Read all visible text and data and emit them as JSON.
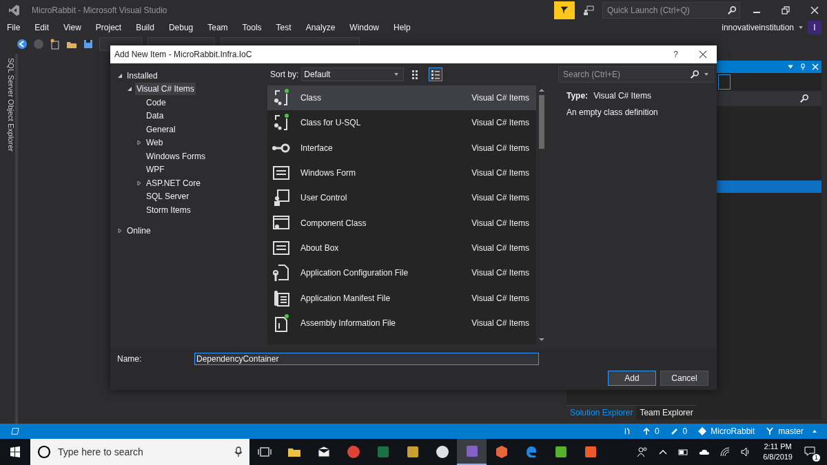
{
  "window": {
    "title": "MicroRabbit - Microsoft Visual Studio",
    "quick_launch": {
      "placeholder": "Quick Launch (Ctrl+Q)"
    },
    "account": "innovativeinstitution",
    "avatar": "I"
  },
  "menu": [
    "File",
    "Edit",
    "View",
    "Project",
    "Build",
    "Debug",
    "Team",
    "Tools",
    "Test",
    "Analyze",
    "Window",
    "Help"
  ],
  "side_tab": "SQL Server Object Explorer",
  "dialog": {
    "title": "Add New Item - MicroRabbit.Infra.IoC",
    "help": "?",
    "tree": [
      {
        "label": "Installed",
        "expanded": true,
        "selected": false,
        "children": [
          {
            "label": "Visual C# Items",
            "expanded": true,
            "selected": true,
            "children": [
              {
                "label": "Code",
                "selected": false
              },
              {
                "label": "Data",
                "selected": false
              },
              {
                "label": "General",
                "selected": false
              },
              {
                "label": "Web",
                "expanded": false,
                "selected": false
              },
              {
                "label": "Windows Forms",
                "selected": false
              },
              {
                "label": "WPF",
                "selected": false
              },
              {
                "label": "ASP.NET Core",
                "expanded": false,
                "selected": false
              },
              {
                "label": "SQL Server",
                "selected": false
              },
              {
                "label": "Storm Items",
                "selected": false
              }
            ]
          }
        ]
      },
      {
        "label": "Online",
        "expanded": false,
        "selected": false
      }
    ],
    "sort_by": {
      "label": "Sort by:",
      "value": "Default"
    },
    "view_modes": [
      {
        "kind": "grid",
        "selected": false
      },
      {
        "kind": "list",
        "selected": true
      }
    ],
    "search": {
      "placeholder": "Search (Ctrl+E)"
    },
    "templates": [
      {
        "name": "Class",
        "category": "Visual C# Items",
        "kind": "class",
        "selected": true
      },
      {
        "name": "Class for U-SQL",
        "category": "Visual C# Items",
        "kind": "class",
        "selected": false
      },
      {
        "name": "Interface",
        "category": "Visual C# Items",
        "kind": "interface",
        "selected": false
      },
      {
        "name": "Windows Form",
        "category": "Visual C# Items",
        "kind": "form",
        "selected": false
      },
      {
        "name": "User Control",
        "category": "Visual C# Items",
        "kind": "user",
        "selected": false
      },
      {
        "name": "Component Class",
        "category": "Visual C# Items",
        "kind": "component",
        "selected": false
      },
      {
        "name": "About Box",
        "category": "Visual C# Items",
        "kind": "about",
        "selected": false
      },
      {
        "name": "Application Configuration File",
        "category": "Visual C# Items",
        "kind": "config",
        "selected": false
      },
      {
        "name": "Application Manifest File",
        "category": "Visual C# Items",
        "kind": "manifest",
        "selected": false
      },
      {
        "name": "Assembly Information File",
        "category": "Visual C# Items",
        "kind": "info",
        "selected": false
      }
    ],
    "details": {
      "type_label": "Type:",
      "type_value": "Visual C# Items",
      "description": "An empty class definition"
    },
    "name_label": "Name:",
    "name_value": "DependencyContainer",
    "buttons": [
      {
        "label": "Add",
        "default": true
      },
      {
        "label": "Cancel",
        "default": false
      }
    ]
  },
  "solution_panel": {
    "tabs": [
      {
        "label": "Solution Explorer",
        "selected": true
      },
      {
        "label": "Team Explorer",
        "selected": false
      }
    ]
  },
  "status_bar": {
    "pushes": "0",
    "changes": "0",
    "repo": "MicroRabbit",
    "branch": "master"
  },
  "taskbar": {
    "search_placeholder": "Type here to search",
    "apps": [
      {
        "kind": "taskview",
        "selected": false
      },
      {
        "kind": "folder",
        "selected": false
      },
      {
        "kind": "mail",
        "selected": false
      },
      {
        "kind": "chrome",
        "selected": false
      },
      {
        "kind": "excel",
        "selected": false
      },
      {
        "kind": "tool",
        "selected": false
      },
      {
        "kind": "slack",
        "selected": false
      },
      {
        "kind": "vs",
        "selected": true
      },
      {
        "kind": "cube",
        "selected": false
      },
      {
        "kind": "edge",
        "selected": false
      },
      {
        "kind": "greenc",
        "selected": false
      },
      {
        "kind": "orangec",
        "selected": false
      }
    ],
    "time": "2:11 PM",
    "date": "6/8/2019",
    "notifications": "1"
  }
}
